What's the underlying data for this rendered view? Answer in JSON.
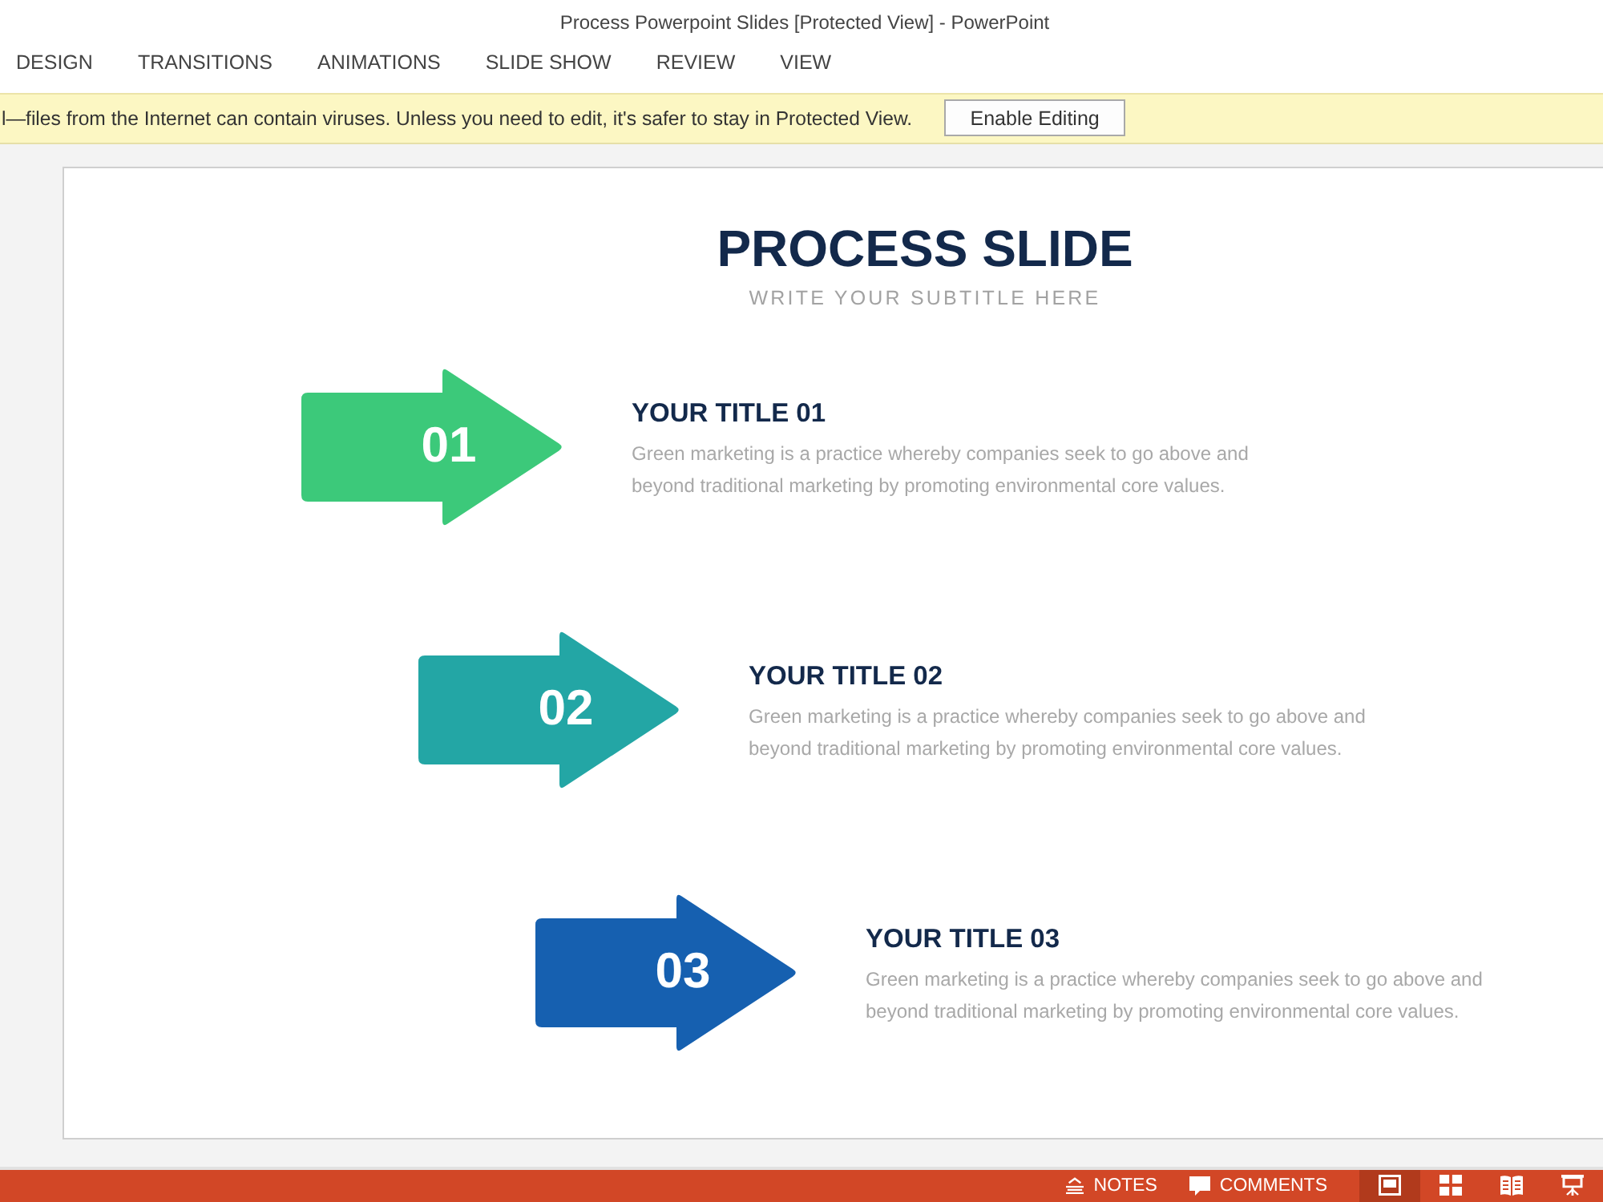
{
  "window": {
    "title": "Process Powerpoint Slides [Protected View] - PowerPoint"
  },
  "ribbon_tabs": [
    {
      "label": "DESIGN",
      "selected": false
    },
    {
      "label": "TRANSITIONS",
      "selected": false
    },
    {
      "label": "ANIMATIONS",
      "selected": false
    },
    {
      "label": "SLIDE SHOW",
      "selected": false
    },
    {
      "label": "REVIEW",
      "selected": false
    },
    {
      "label": "VIEW",
      "selected": false
    }
  ],
  "message_bar": {
    "text": "l—files from the Internet can contain viruses. Unless you need to edit, it's safer to stay in Protected View.",
    "button": "Enable Editing"
  },
  "slide": {
    "title": "PROCESS SLIDE",
    "subtitle": "WRITE YOUR SUBTITLE HERE",
    "steps": [
      {
        "number": "01",
        "title": "YOUR TITLE 01",
        "description": "Green marketing is a practice whereby companies seek to go above and beyond traditional marketing by promoting environmental core values.",
        "color": "#3cc97a"
      },
      {
        "number": "02",
        "title": "YOUR TITLE 02",
        "description": "Green marketing is a practice whereby companies seek to go above and beyond traditional marketing by promoting environmental core values.",
        "color": "#23a6a5"
      },
      {
        "number": "03",
        "title": "YOUR TITLE 03",
        "description": "Green marketing is a practice whereby companies seek to go above and beyond traditional marketing by promoting environmental core values.",
        "color": "#1660b0"
      }
    ]
  },
  "status_bar": {
    "notes": "NOTES",
    "comments": "COMMENTS",
    "views": [
      {
        "kind": "normal",
        "selected": true
      },
      {
        "kind": "slide_sorter",
        "selected": false
      },
      {
        "kind": "reading",
        "selected": false
      },
      {
        "kind": "slide_show",
        "selected": false
      }
    ]
  }
}
